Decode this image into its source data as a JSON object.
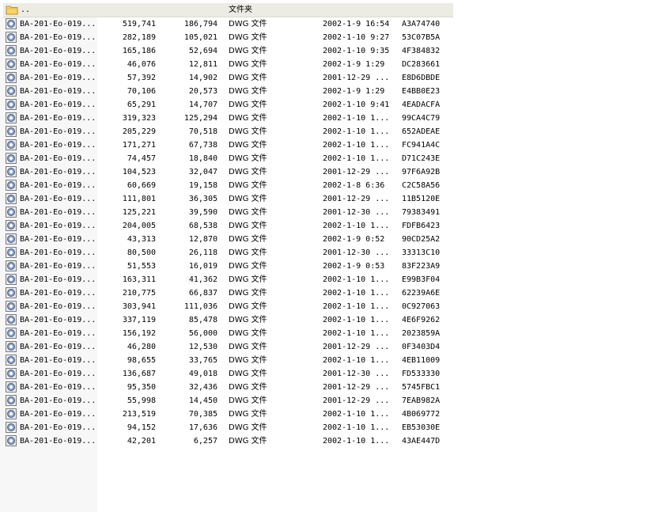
{
  "parent_row": {
    "name": "..",
    "type": "文件夹"
  },
  "files": [
    {
      "name": "BA-201-Eo-019...",
      "size": "519,741",
      "packed": "186,794",
      "type": "DWG 文件",
      "modified": "2002-1-9 16:54",
      "crc": "A3A74740"
    },
    {
      "name": "BA-201-Eo-019...",
      "size": "282,189",
      "packed": "105,021",
      "type": "DWG 文件",
      "modified": "2002-1-10 9:27",
      "crc": "53C07B5A"
    },
    {
      "name": "BA-201-Eo-019...",
      "size": "165,186",
      "packed": "52,694",
      "type": "DWG 文件",
      "modified": "2002-1-10 9:35",
      "crc": "4F384832"
    },
    {
      "name": "BA-201-Eo-019...",
      "size": "46,076",
      "packed": "12,811",
      "type": "DWG 文件",
      "modified": "2002-1-9 1:29",
      "crc": "DC283661"
    },
    {
      "name": "BA-201-Eo-019...",
      "size": "57,392",
      "packed": "14,902",
      "type": "DWG 文件",
      "modified": "2001-12-29 ...",
      "crc": "E8D6DBDE"
    },
    {
      "name": "BA-201-Eo-019...",
      "size": "70,106",
      "packed": "20,573",
      "type": "DWG 文件",
      "modified": "2002-1-9 1:29",
      "crc": "E4BB0E23"
    },
    {
      "name": "BA-201-Eo-019...",
      "size": "65,291",
      "packed": "14,707",
      "type": "DWG 文件",
      "modified": "2002-1-10 9:41",
      "crc": "4EADACFA"
    },
    {
      "name": "BA-201-Eo-019...",
      "size": "319,323",
      "packed": "125,294",
      "type": "DWG 文件",
      "modified": "2002-1-10 1...",
      "crc": "99CA4C79"
    },
    {
      "name": "BA-201-Eo-019...",
      "size": "205,229",
      "packed": "70,518",
      "type": "DWG 文件",
      "modified": "2002-1-10 1...",
      "crc": "652ADEAE"
    },
    {
      "name": "BA-201-Eo-019...",
      "size": "171,271",
      "packed": "67,738",
      "type": "DWG 文件",
      "modified": "2002-1-10 1...",
      "crc": "FC941A4C"
    },
    {
      "name": "BA-201-Eo-019...",
      "size": "74,457",
      "packed": "18,840",
      "type": "DWG 文件",
      "modified": "2002-1-10 1...",
      "crc": "D71C243E"
    },
    {
      "name": "BA-201-Eo-019...",
      "size": "104,523",
      "packed": "32,047",
      "type": "DWG 文件",
      "modified": "2001-12-29 ...",
      "crc": "97F6A92B"
    },
    {
      "name": "BA-201-Eo-019...",
      "size": "60,669",
      "packed": "19,158",
      "type": "DWG 文件",
      "modified": "2002-1-8 6:36",
      "crc": "C2C58A56"
    },
    {
      "name": "BA-201-Eo-019...",
      "size": "111,801",
      "packed": "36,305",
      "type": "DWG 文件",
      "modified": "2001-12-29 ...",
      "crc": "11B5120E"
    },
    {
      "name": "BA-201-Eo-019...",
      "size": "125,221",
      "packed": "39,590",
      "type": "DWG 文件",
      "modified": "2001-12-30 ...",
      "crc": "79383491"
    },
    {
      "name": "BA-201-Eo-019...",
      "size": "204,005",
      "packed": "68,538",
      "type": "DWG 文件",
      "modified": "2002-1-10 1...",
      "crc": "FDFB6423"
    },
    {
      "name": "BA-201-Eo-019...",
      "size": "43,313",
      "packed": "12,870",
      "type": "DWG 文件",
      "modified": "2002-1-9 0:52",
      "crc": "90CD25A2"
    },
    {
      "name": "BA-201-Eo-019...",
      "size": "80,500",
      "packed": "26,118",
      "type": "DWG 文件",
      "modified": "2001-12-30 ...",
      "crc": "33313C10"
    },
    {
      "name": "BA-201-Eo-019...",
      "size": "51,553",
      "packed": "16,019",
      "type": "DWG 文件",
      "modified": "2002-1-9 0:53",
      "crc": "83F223A9"
    },
    {
      "name": "BA-201-Eo-019...",
      "size": "163,311",
      "packed": "41,362",
      "type": "DWG 文件",
      "modified": "2002-1-10 1...",
      "crc": "E99B3F04"
    },
    {
      "name": "BA-201-Eo-019...",
      "size": "210,775",
      "packed": "66,837",
      "type": "DWG 文件",
      "modified": "2002-1-10 1...",
      "crc": "62239A6E"
    },
    {
      "name": "BA-201-Eo-019...",
      "size": "303,941",
      "packed": "111,036",
      "type": "DWG 文件",
      "modified": "2002-1-10 1...",
      "crc": "0C927063"
    },
    {
      "name": "BA-201-Eo-019...",
      "size": "337,119",
      "packed": "85,478",
      "type": "DWG 文件",
      "modified": "2002-1-10 1...",
      "crc": "4E6F9262"
    },
    {
      "name": "BA-201-Eo-019...",
      "size": "156,192",
      "packed": "56,000",
      "type": "DWG 文件",
      "modified": "2002-1-10 1...",
      "crc": "2023859A"
    },
    {
      "name": "BA-201-Eo-019...",
      "size": "46,280",
      "packed": "12,530",
      "type": "DWG 文件",
      "modified": "2001-12-29 ...",
      "crc": "0F3403D4"
    },
    {
      "name": "BA-201-Eo-019...",
      "size": "98,655",
      "packed": "33,765",
      "type": "DWG 文件",
      "modified": "2002-1-10 1...",
      "crc": "4EB11009"
    },
    {
      "name": "BA-201-Eo-019...",
      "size": "136,687",
      "packed": "49,018",
      "type": "DWG 文件",
      "modified": "2001-12-30 ...",
      "crc": "FD533330"
    },
    {
      "name": "BA-201-Eo-019...",
      "size": "95,350",
      "packed": "32,436",
      "type": "DWG 文件",
      "modified": "2001-12-29 ...",
      "crc": "5745FBC1"
    },
    {
      "name": "BA-201-Eo-019...",
      "size": "55,998",
      "packed": "14,450",
      "type": "DWG 文件",
      "modified": "2001-12-29 ...",
      "crc": "7EAB982A"
    },
    {
      "name": "BA-201-Eo-019...",
      "size": "213,519",
      "packed": "70,385",
      "type": "DWG 文件",
      "modified": "2002-1-10 1...",
      "crc": "4B069772"
    },
    {
      "name": "BA-201-Eo-019...",
      "size": "94,152",
      "packed": "17,636",
      "type": "DWG 文件",
      "modified": "2002-1-10 1...",
      "crc": "EB53030E"
    },
    {
      "name": "BA-201-Eo-019...",
      "size": "42,201",
      "packed": "6,257",
      "type": "DWG 文件",
      "modified": "2002-1-10 1...",
      "crc": "43AE447D"
    }
  ]
}
